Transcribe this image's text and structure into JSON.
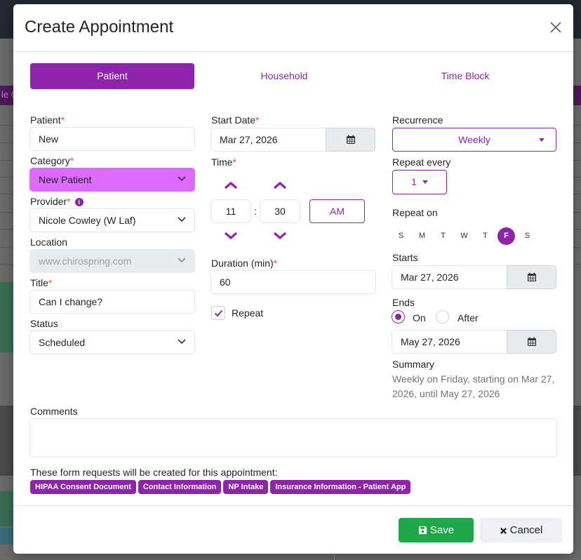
{
  "background": {
    "purple_text": "le C"
  },
  "modal": {
    "title": "Create Appointment"
  },
  "tabs": [
    {
      "label": "Patient"
    },
    {
      "label": "Household"
    },
    {
      "label": "Time Block"
    }
  ],
  "patient": {
    "label": "Patient",
    "value": "New"
  },
  "category": {
    "label": "Category",
    "value": "New Patient"
  },
  "provider": {
    "label": "Provider",
    "value": "Nicole Cowley (W Laf)"
  },
  "location": {
    "label": "Location",
    "value": "www.chirospring.com"
  },
  "title_field": {
    "label": "Title",
    "value": "Can I change?"
  },
  "status": {
    "label": "Status",
    "value": "Scheduled"
  },
  "start_date": {
    "label": "Start Date",
    "value": "Mar 27, 2026"
  },
  "time": {
    "label": "Time",
    "hour": "11",
    "separator": ":",
    "minute": "30",
    "ampm": "AM"
  },
  "duration": {
    "label": "Duration (min)",
    "value": "60"
  },
  "repeat": {
    "label": "Repeat",
    "checked": true
  },
  "recurrence": {
    "label": "Recurrence",
    "value": "Weekly",
    "repeat_every_label": "Repeat every",
    "repeat_every_value": "1",
    "repeat_on_label": "Repeat on",
    "days": [
      "S",
      "M",
      "T",
      "W",
      "T",
      "F",
      "S"
    ],
    "selected_day_index": 5,
    "starts_label": "Starts",
    "starts_value": "Mar 27, 2026",
    "ends_label": "Ends",
    "ends_on_label": "On",
    "ends_after_label": "After",
    "ends_value": "May 27, 2026",
    "summary_label": "Summary",
    "summary_text": "Weekly on Friday, starting on Mar 27, 2026, until May 27, 2026"
  },
  "comments": {
    "label": "Comments",
    "value": ""
  },
  "forms": {
    "label": "These form requests will be created for this appointment:",
    "items": [
      "HIPAA Consent Document",
      "Contact Information",
      "NP Intake",
      "Insurance Information - Patient App"
    ]
  },
  "footer": {
    "save_label": "Save",
    "cancel_label": "Cancel"
  },
  "colors": {
    "accent": "#8e24aa",
    "category_fill": "#df6aff",
    "save": "#1fa84a",
    "required": "#d9534f"
  }
}
